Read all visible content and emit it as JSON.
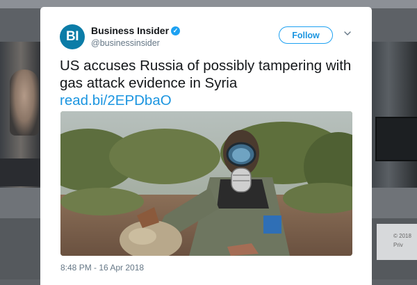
{
  "tweet": {
    "author_name": "Business Insider",
    "author_handle": "@businessinsider",
    "avatar_text": "BI",
    "verified": true,
    "follow_label": "Follow",
    "text": "US accuses Russia of possibly tampering with gas attack evidence in Syria",
    "link": "read.bi/2EPDbaO",
    "timestamp": "8:48 PM - 16 Apr 2018",
    "media_description": "Man wearing a gas mask holding a rock in an olive grove"
  },
  "background_footer": {
    "line1": "© 2018",
    "line2": "Priv"
  },
  "colors": {
    "accent": "#1da1f2",
    "link": "#1b95e0",
    "avatar_bg": "#0b7ca7",
    "text": "#14171a",
    "muted": "#657786"
  }
}
